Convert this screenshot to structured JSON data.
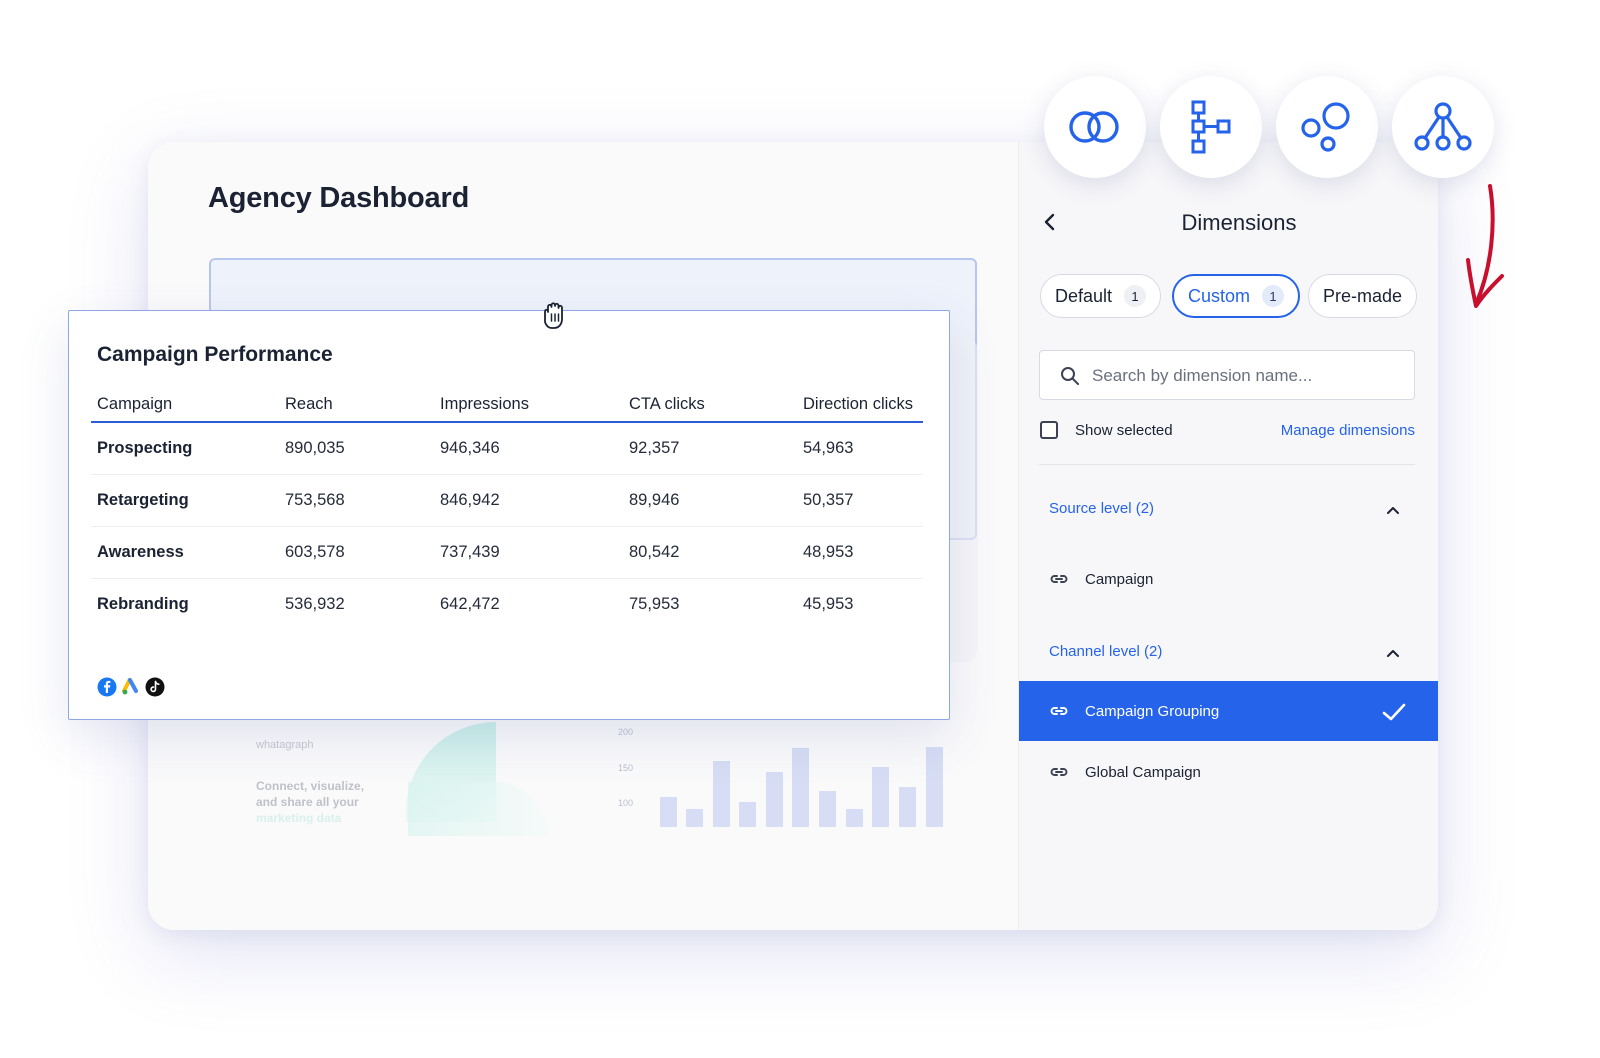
{
  "dashboard": {
    "title": "Agency Dashboard"
  },
  "watermark": {
    "logo": "whatagraph",
    "tagline_1": "Connect, visualize,",
    "tagline_2": "and share all your",
    "tagline_3": "marketing data",
    "chart_ticks": [
      "200",
      "150",
      "100"
    ]
  },
  "widget": {
    "title": "Campaign Performance",
    "columns": [
      "Campaign",
      "Reach",
      "Impressions",
      "CTA clicks",
      "Direction clicks"
    ],
    "rows": [
      [
        "Prospecting",
        "890,035",
        "946,346",
        "92,357",
        "54,963"
      ],
      [
        "Retargeting",
        "753,568",
        "846,942",
        "89,946",
        "50,357"
      ],
      [
        "Awareness",
        "603,578",
        "737,439",
        "80,542",
        "48,953"
      ],
      [
        "Rebranding",
        "536,932",
        "642,472",
        "75,953",
        "45,953"
      ]
    ],
    "source_icons": [
      "facebook-icon",
      "google-ads-icon",
      "tiktok-icon"
    ]
  },
  "panel": {
    "title": "Dimensions",
    "tabs": [
      {
        "label": "Default",
        "count": "1"
      },
      {
        "label": "Custom",
        "count": "1",
        "active": true
      },
      {
        "label": "Pre-made"
      }
    ],
    "search_placeholder": "Search by dimension name...",
    "show_selected": "Show selected",
    "manage_link": "Manage dimensions",
    "groups": [
      {
        "label": "Source level (2)",
        "items": [
          {
            "label": "Campaign",
            "selected": false
          }
        ]
      },
      {
        "label": "Channel level (2)",
        "items": [
          {
            "label": "Campaign Grouping",
            "selected": true
          },
          {
            "label": "Global Campaign",
            "selected": false
          }
        ]
      }
    ]
  },
  "toolbar": {
    "tools": [
      "blend-icon",
      "hierarchy-icon",
      "bubbles-icon",
      "network-icon"
    ]
  },
  "colors": {
    "accent": "#2563eb",
    "arrow": "#c8102e"
  }
}
